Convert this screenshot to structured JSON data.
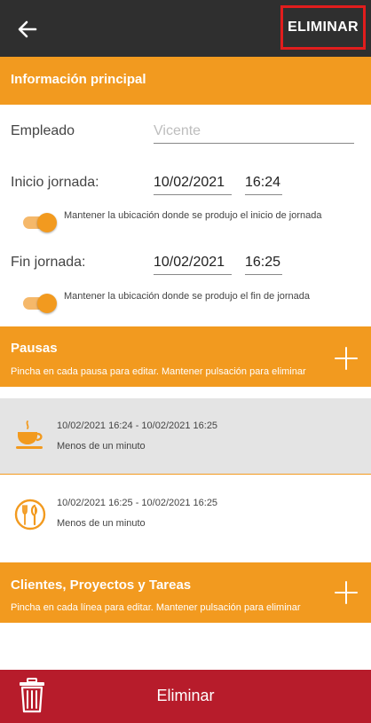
{
  "topbar": {
    "delete_label": "ELIMINAR"
  },
  "main_info": {
    "title": "Información principal",
    "employee_label": "Empleado",
    "employee_placeholder": "Vicente",
    "start_label": "Inicio jornada:",
    "start_date": "10/02/2021",
    "start_time": "16:24",
    "start_location_toggle": "Mantener la ubicación donde se produjo el inicio de jornada",
    "end_label": "Fin jornada:",
    "end_date": "10/02/2021",
    "end_time": "16:25",
    "end_location_toggle": "Mantener la ubicación donde se produjo el fin de jornada"
  },
  "pauses": {
    "title": "Pausas",
    "hint": "Pincha en cada pausa para editar. Mantener pulsación para eliminar",
    "items": [
      {
        "icon": "coffee-cup-icon",
        "range": "10/02/2021 16:24  -  10/02/2021 16:25",
        "duration": "Menos de un minuto"
      },
      {
        "icon": "cutlery-icon",
        "range": "10/02/2021 16:25  -  10/02/2021 16:25",
        "duration": "Menos de un minuto"
      }
    ]
  },
  "clients": {
    "title": "Clientes, Proyectos y Tareas",
    "hint": "Pincha en cada línea para editar. Mantener pulsación para eliminar"
  },
  "bottom": {
    "delete_label": "Eliminar"
  },
  "colors": {
    "accent": "#f29a1f",
    "toolbar": "#2f2f2f",
    "danger": "#b71c2b",
    "selected_row": "#e4e4e4"
  }
}
